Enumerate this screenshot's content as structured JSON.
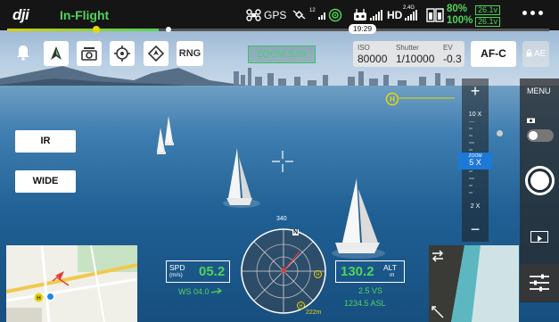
{
  "topbar": {
    "logo": "dji",
    "flight_status": "In-Flight",
    "gps_label": "GPS",
    "gps_signal_count": "12",
    "rc_signal_label": "2.4G",
    "hd_label": "HD",
    "battery_aircraft_pct": "80%",
    "battery_rc_pct": "100%",
    "battery_aircraft_volt": "26.1v",
    "battery_rc_volt": "26.1v",
    "flight_time": "19:29",
    "flight_progress": 0.28,
    "status_color": "#52d35c",
    "icons": [
      "drone-icon",
      "satellite-icon",
      "vision-system-icon",
      "remote-controller-icon",
      "signal-bars-icon",
      "battery-icon",
      "more-icon"
    ]
  },
  "toolbar": {
    "icons": [
      "bell-icon",
      "flight-mode-icon",
      "camera-mode-icon",
      "target-icon",
      "waypoint-icon"
    ],
    "rng_label": "RNG"
  },
  "camera": {
    "zoom_label": "ZOOM 5.0x",
    "iso_label": "ISO",
    "iso_value": "80000",
    "shutter_label": "Shutter",
    "shutter_value": "1/10000",
    "ev_label": "EV",
    "ev_value": "-0.3",
    "focus_mode": "AF-C",
    "ae_lock_label": "AE"
  },
  "zoom_control": {
    "plus": "+",
    "minus": "−",
    "tick_top": "10 X",
    "tick_bottom": "2 X",
    "selected_caption": "ZOOM",
    "selected_value": "5 X",
    "accent": "#1e78d6"
  },
  "right_panel": {
    "menu_label": "MENU"
  },
  "modes": {
    "ir_label": "IR",
    "wide_label": "WIDE"
  },
  "telemetry": {
    "spd_label": "SPD",
    "spd_unit": "(m/s)",
    "spd_value": "05.2",
    "vs_horizontal_label": "WS 04.0",
    "alt_label": "ALT",
    "alt_unit": "m",
    "alt_value": "130.2",
    "vs_label": "2.5 VS",
    "asl_label": "1234.5 ASL",
    "heading": "340",
    "heading_n": "N",
    "distance_label": "222m"
  }
}
